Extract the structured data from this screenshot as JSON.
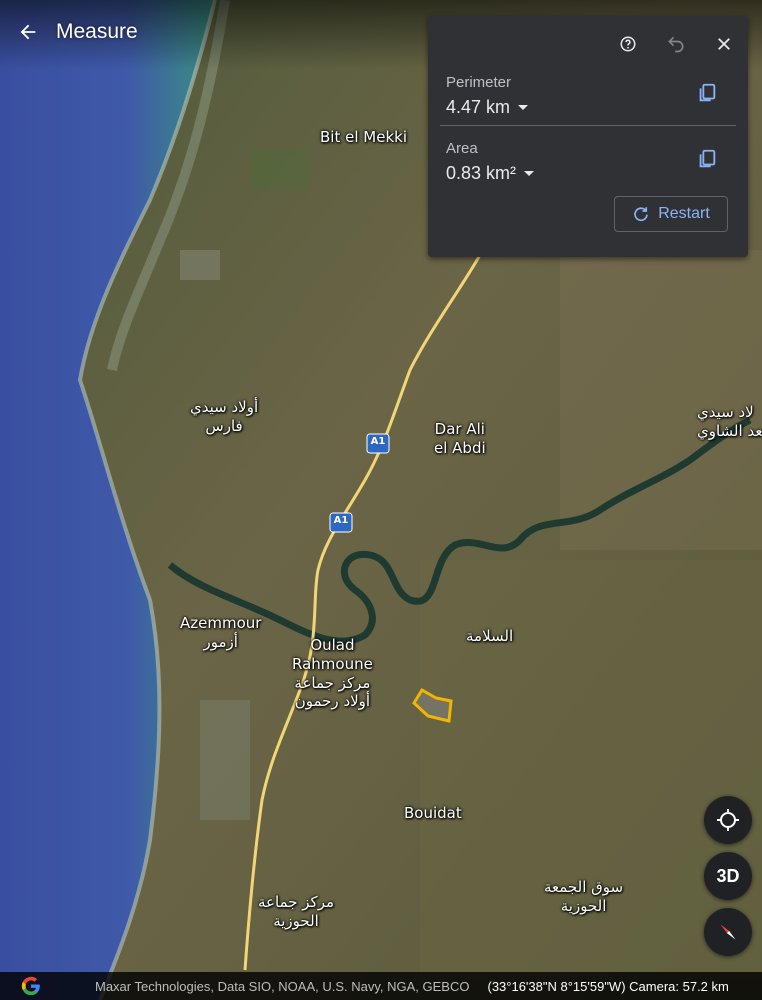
{
  "header": {
    "title": "Measure"
  },
  "panel": {
    "perimeter_label": "Perimeter",
    "perimeter_value": "4.47 km",
    "area_label": "Area",
    "area_value": "0.83 km²",
    "restart_label": "Restart"
  },
  "map": {
    "labels": {
      "bit_el_mekki": "Bit el Mekki",
      "oulad_sidi_faris": "أولاد سيدي\nفارس",
      "dar_ali_el_abdi": "Dar Ali\nel Abdi",
      "oulad_sidi_chaoui": "لاد سيدي\nبعد الشاوي",
      "azemmour": "Azemmour\nأزمور",
      "oulad_rahmoune": "Oulad\nRahmoune\nمركز جماعة\nأولاد رحمون",
      "salama": "السلامة",
      "bouidat": "Bouidat",
      "souk_jemaa_haouzia": "سوق الجمعة\nالحوزية",
      "markaz_haouzia": "مركز جماعة\nالحوزية"
    },
    "shields": {
      "a1_top": "A1",
      "a1_bottom": "A1"
    }
  },
  "controls": {
    "three_d_label": "3D"
  },
  "footer": {
    "attribution": "Maxar Technologies, Data SIO, NOAA, U.S. Navy, NGA, GEBCO",
    "coordinates": "(33°16'38\"N 8°15'59\"W) Camera: 57.2 km"
  },
  "colors": {
    "panel_bg": "#303134",
    "accent_blue": "#8ab4f8",
    "measure_outline": "#f4b400",
    "road": "#f2d675"
  },
  "icons": {
    "back": "arrow-left-icon",
    "help": "help-circle-icon",
    "undo": "undo-icon",
    "close": "close-icon",
    "copy": "copy-icon",
    "restart": "refresh-icon",
    "locate": "my-location-icon",
    "compass": "compass-icon",
    "google": "google-g-logo"
  }
}
